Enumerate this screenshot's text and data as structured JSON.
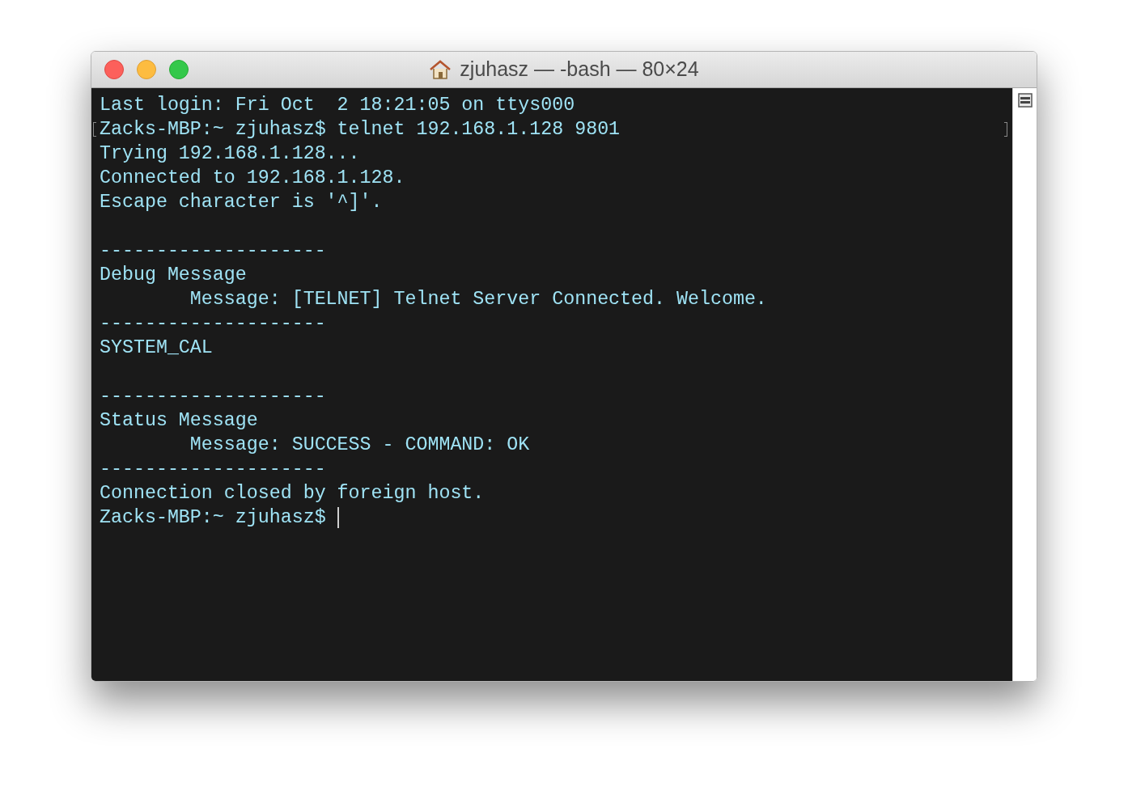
{
  "window": {
    "title": "zjuhasz — -bash — 80×24"
  },
  "lines": [
    {
      "kind": "text",
      "text": "Last login: Fri Oct  2 18:21:05 on ttys000"
    },
    {
      "kind": "text",
      "text": "Zacks-MBP:~ zjuhasz$ telnet 192.168.1.128 9801",
      "marked": true
    },
    {
      "kind": "text",
      "text": "Trying 192.168.1.128..."
    },
    {
      "kind": "text",
      "text": "Connected to 192.168.1.128."
    },
    {
      "kind": "text",
      "text": "Escape character is '^]'."
    },
    {
      "kind": "blank"
    },
    {
      "kind": "text",
      "text": "--------------------"
    },
    {
      "kind": "text",
      "text": "Debug Message"
    },
    {
      "kind": "text",
      "text": "        Message: [TELNET] Telnet Server Connected. Welcome."
    },
    {
      "kind": "text",
      "text": "--------------------"
    },
    {
      "kind": "text",
      "text": "SYSTEM_CAL"
    },
    {
      "kind": "blank"
    },
    {
      "kind": "text",
      "text": "--------------------"
    },
    {
      "kind": "text",
      "text": "Status Message"
    },
    {
      "kind": "text",
      "text": "        Message: SUCCESS - COMMAND: OK"
    },
    {
      "kind": "text",
      "text": "--------------------"
    },
    {
      "kind": "text",
      "text": "Connection closed by foreign host."
    },
    {
      "kind": "text",
      "text": "Zacks-MBP:~ zjuhasz$ ",
      "cursor": true
    }
  ]
}
